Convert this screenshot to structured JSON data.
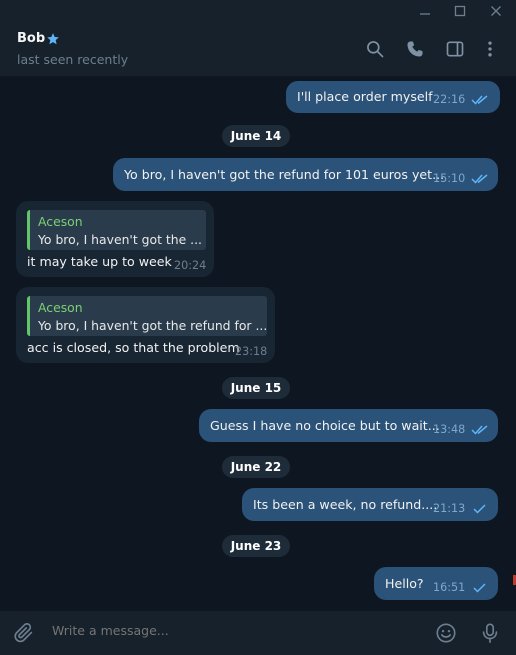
{
  "header": {
    "contact_name": "Bob",
    "status": "last seen recently"
  },
  "messages": [
    {
      "text": "I'll place order myself",
      "time": "22:16"
    },
    {
      "date": "June 14"
    },
    {
      "text": "Yo bro, I haven't got the refund for 101 euros yet...",
      "time": "15:10"
    },
    {
      "quote_name": "Aceson",
      "quote_text": "Yo bro, I haven't got the ...",
      "text": "it may take up to week",
      "time": "20:24"
    },
    {
      "quote_name": "Aceson",
      "quote_text": "Yo bro, I haven't got the refund for ...",
      "text": "acc is closed, so that the problem",
      "time": "23:18"
    },
    {
      "date": "June 15"
    },
    {
      "text": "Guess I have no choice but to wait...",
      "time": "13:48"
    },
    {
      "date": "June 22"
    },
    {
      "text": "Its been a week, no refund....",
      "time": "21:13"
    },
    {
      "date": "June 23"
    },
    {
      "text": "Hello?",
      "time": "16:51"
    }
  ],
  "composer": {
    "placeholder": "Write a message..."
  },
  "icons": {
    "window": [
      "minimize-icon",
      "maximize-icon",
      "close-icon"
    ],
    "header": [
      "star-icon",
      "search-icon",
      "phone-icon",
      "sidebar-icon",
      "more-icon"
    ],
    "composer": [
      "attach-icon",
      "emoji-icon",
      "microphone-icon"
    ]
  },
  "colors": {
    "background": "#0e1621",
    "panel": "#17212b",
    "outgoing_bubble": "#2b5278",
    "incoming_bubble": "#182533",
    "accent": "#5eb5f7",
    "quote_accent": "#63c66a"
  }
}
